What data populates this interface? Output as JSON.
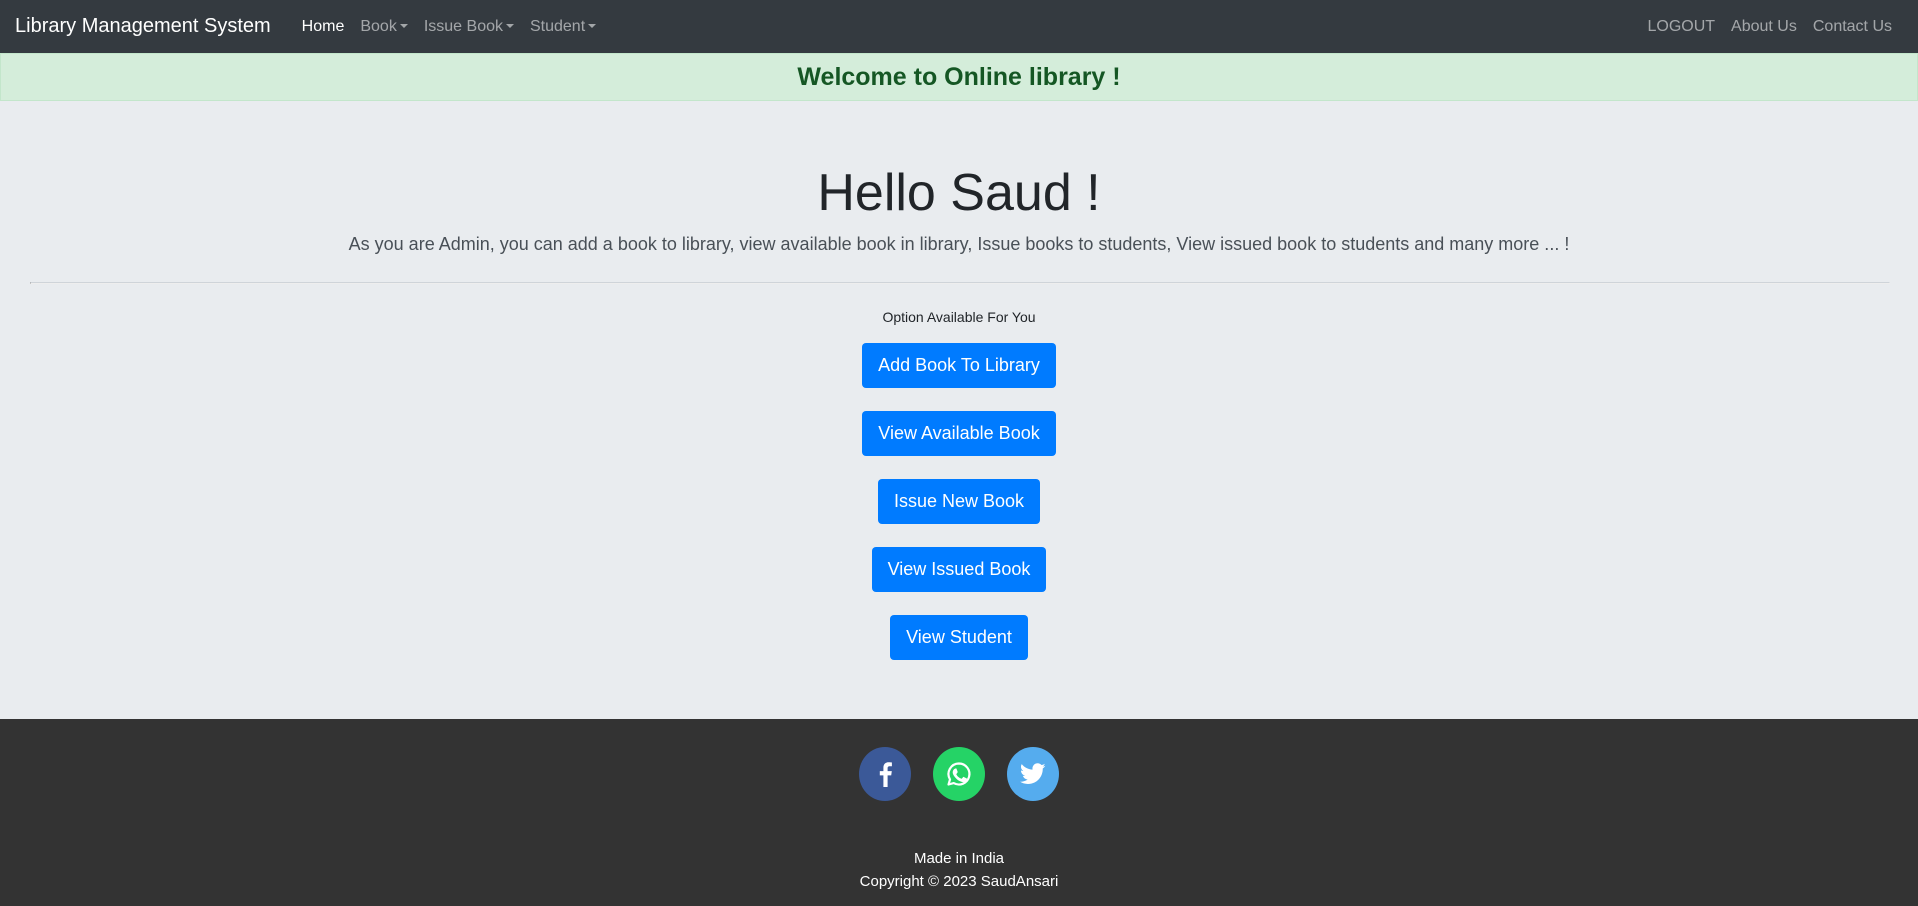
{
  "navbar": {
    "brand": "Library Management System",
    "left_items": [
      {
        "label": "Home"
      },
      {
        "label": "Book"
      },
      {
        "label": "Issue Book"
      },
      {
        "label": "Student"
      }
    ],
    "right_items": [
      {
        "label": "LOGOUT"
      },
      {
        "label": "About Us"
      },
      {
        "label": "Contact Us"
      }
    ]
  },
  "alert": {
    "text": "Welcome to Online library !"
  },
  "main": {
    "greeting": "Hello Saud !",
    "lead": "As you are Admin, you can add a book to library, view available book in library, Issue books to students, View issued book to students and many more ... !",
    "options_label": "Option Available For You",
    "buttons": [
      {
        "label": "Add Book To Library"
      },
      {
        "label": "View Available Book"
      },
      {
        "label": "Issue New Book"
      },
      {
        "label": "View Issued Book"
      },
      {
        "label": "View Student"
      }
    ]
  },
  "footer": {
    "social": [
      {
        "icon": "facebook-icon",
        "color": "#3b5998"
      },
      {
        "icon": "whatsapp-icon",
        "color": "#25d366"
      },
      {
        "icon": "twitter-icon",
        "color": "#55acee"
      }
    ],
    "made_in": "Made in India",
    "copyright": "Copyright © 2023 SaudAnsari"
  },
  "colors": {
    "navbar_bg": "#343a40",
    "alert_bg": "#d4edda",
    "alert_text": "#155724",
    "primary": "#007bff",
    "page_bg": "#e9ecef",
    "footer_bg": "#333333"
  }
}
